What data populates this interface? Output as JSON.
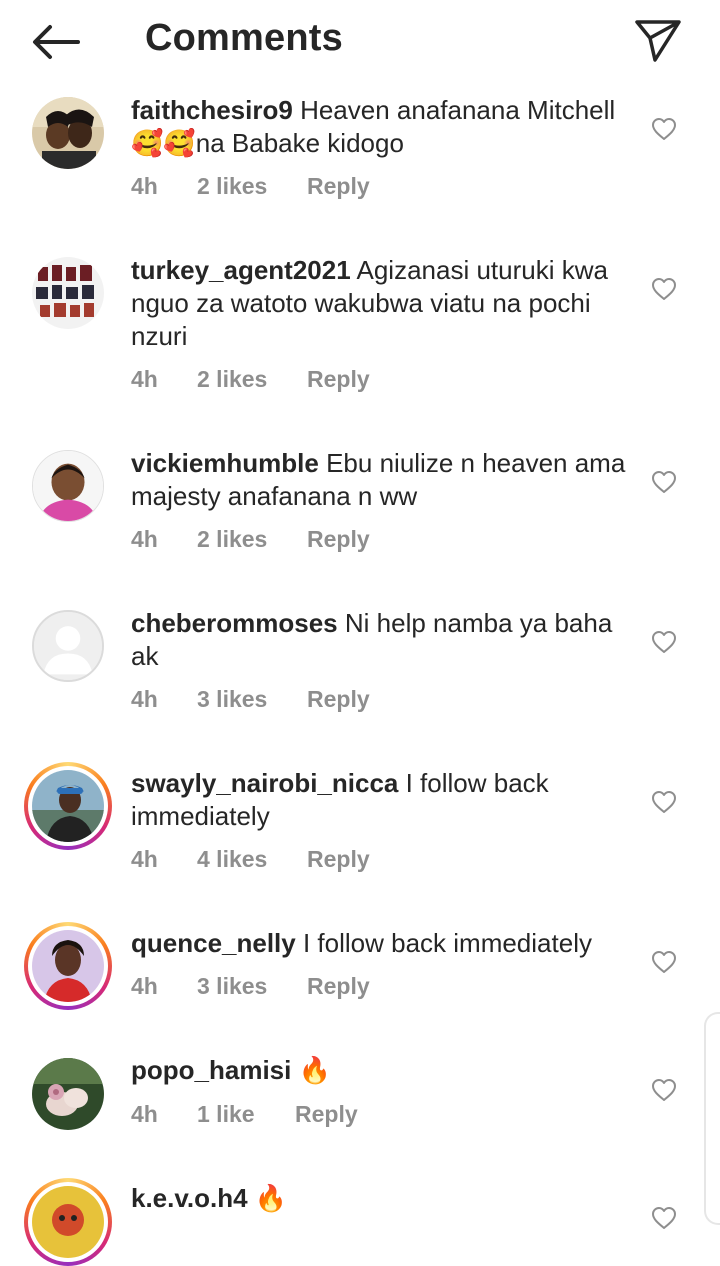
{
  "header": {
    "title": "Comments"
  },
  "comments": [
    {
      "username": "faithchesiro9",
      "text": "Heaven anafanana Mitchell 🥰🥰na Babake kidogo",
      "time": "4h",
      "likes": "2 likes",
      "reply": "Reply"
    },
    {
      "username": "turkey_agent2021",
      "text": "Agizanasi uturuki kwa nguo za watoto wakubwa viatu na pochi nzuri",
      "time": "4h",
      "likes": "2 likes",
      "reply": "Reply"
    },
    {
      "username": "vickiemhumble",
      "text": "Ebu niulize n heaven ama majesty anafanana n ww",
      "time": "4h",
      "likes": "2 likes",
      "reply": "Reply"
    },
    {
      "username": "cheberommoses",
      "text": "Ni help namba ya baha ak",
      "time": "4h",
      "likes": "3 likes",
      "reply": "Reply"
    },
    {
      "username": "swayly_nairobi_nicca",
      "text": "I follow back immediately",
      "time": "4h",
      "likes": "4 likes",
      "reply": "Reply"
    },
    {
      "username": "quence_nelly",
      "text": "I follow back immediately",
      "time": "4h",
      "likes": "3 likes",
      "reply": "Reply"
    },
    {
      "username": "popo_hamisi",
      "text": "🔥",
      "time": "4h",
      "likes": "1 like",
      "reply": "Reply"
    },
    {
      "username": "k.e.v.o.h4",
      "text": "🔥",
      "time": "",
      "likes": "",
      "reply": ""
    }
  ]
}
